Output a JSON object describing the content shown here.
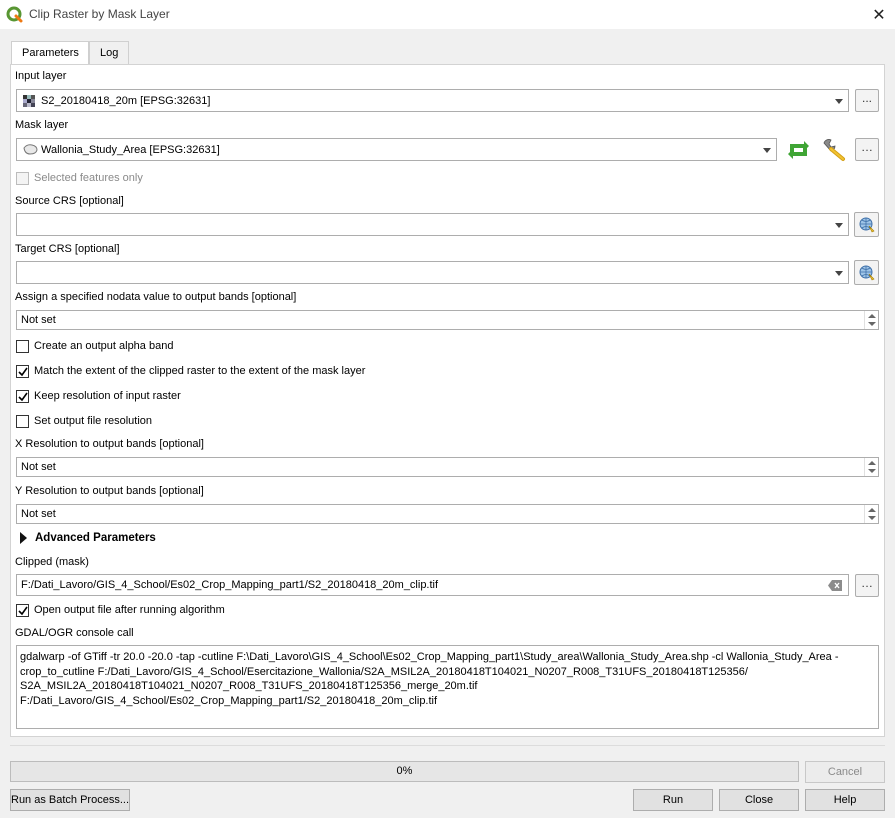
{
  "window": {
    "title": "Clip Raster by Mask Layer"
  },
  "tabs": [
    {
      "label": "Parameters"
    },
    {
      "label": "Log"
    }
  ],
  "input_layer": {
    "label": "Input layer",
    "value": "S2_20180418_20m [EPSG:32631]"
  },
  "mask_layer": {
    "label": "Mask layer",
    "value": "Wallonia_Study_Area [EPSG:32631]"
  },
  "selected_features": {
    "label": "Selected features only",
    "checked": false
  },
  "source_crs": {
    "label": "Source CRS [optional]",
    "value": ""
  },
  "target_crs": {
    "label": "Target CRS [optional]",
    "value": ""
  },
  "nodata": {
    "label": "Assign a specified nodata value to output bands [optional]",
    "value": "Not set"
  },
  "alpha_band": {
    "label": "Create an output alpha band",
    "checked": false
  },
  "match_extent": {
    "label": "Match the extent of the clipped raster to the extent of the mask layer",
    "checked": true
  },
  "keep_resolution": {
    "label": "Keep resolution of input raster",
    "checked": true
  },
  "set_resolution": {
    "label": "Set output file resolution",
    "checked": false
  },
  "x_resolution": {
    "label": "X Resolution to output bands [optional]",
    "value": "Not set"
  },
  "y_resolution": {
    "label": "Y Resolution to output bands [optional]",
    "value": "Not set"
  },
  "advanced": {
    "label": "Advanced Parameters"
  },
  "clipped": {
    "label": "Clipped (mask)",
    "value": "F:/Dati_Lavoro/GIS_4_School/Es02_Crop_Mapping_part1/S2_20180418_20m_clip.tif"
  },
  "open_output": {
    "label": "Open output file after running algorithm",
    "checked": true
  },
  "console": {
    "label": "GDAL/OGR console call",
    "lines": [
      "gdalwarp -of GTiff -tr 20.0 -20.0 -tap -cutline F:\\Dati_Lavoro\\GIS_4_School\\Es02_Crop_Mapping_part1\\Study_area\\Wallonia_Study_Area.shp -cl Wallonia_Study_Area -",
      "crop_to_cutline F:/Dati_Lavoro/GIS_4_School/Esercitazione_Wallonia/S2A_MSIL2A_20180418T104021_N0207_R008_T31UFS_20180418T125356/",
      "S2A_MSIL2A_20180418T104021_N0207_R008_T31UFS_20180418T125356_merge_20m.tif F:/Dati_Lavoro/GIS_4_School/Es02_Crop_Mapping_part1/S2_20180418_20m_clip.tif"
    ]
  },
  "progress": {
    "value": 0,
    "text": "0%"
  },
  "buttons": {
    "cancel": "Cancel",
    "batch": "Run as Batch Process...",
    "run": "Run",
    "close": "Close",
    "help": "Help",
    "dots": "...",
    "ellipsis": "…"
  },
  "colors": {
    "accent_green": "#3fa535",
    "check": "#000000"
  }
}
